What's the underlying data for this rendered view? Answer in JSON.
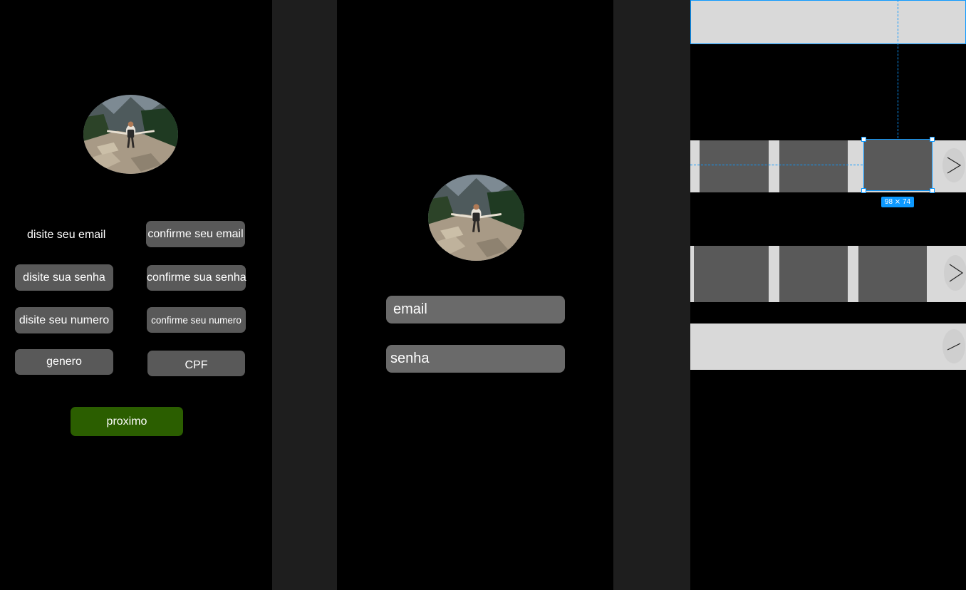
{
  "register": {
    "fields": {
      "email": "disite seu email",
      "confirm_email": "confirme seu email",
      "password": "disite sua senha",
      "confirm_password": "confirme sua senha",
      "number": "disite seu numero",
      "confirm_number": "confirme seu numero",
      "gender": "genero",
      "cpf": "CPF"
    },
    "next_label": "proximo"
  },
  "login": {
    "email_label": "email",
    "password_label": "senha"
  },
  "home": {
    "selection_size": "98 ⨯ 74"
  },
  "colors": {
    "background": "#000000",
    "canvas": "#1e1e1e",
    "field": "#595959",
    "next_button": "#2b5e00",
    "selection": "#0d99ff",
    "band": "#d9d9d9"
  },
  "icons": [
    "profile-photo",
    "chevron-right-icon",
    "chevron-right-icon",
    "slash-icon"
  ]
}
